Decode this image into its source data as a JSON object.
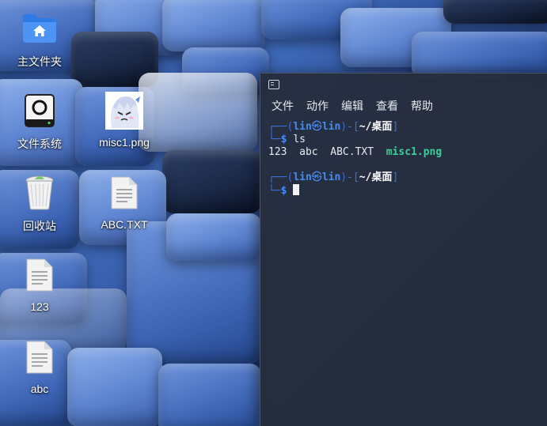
{
  "desktop": {
    "icons": [
      {
        "label": "主文件夹",
        "icon": "home-folder-icon"
      },
      {
        "label": "文件系统",
        "icon": "drive-icon"
      },
      {
        "label": "misc1.png",
        "icon": "image-thumbnail"
      },
      {
        "label": "回收站",
        "icon": "trash-icon"
      },
      {
        "label": "ABC.TXT",
        "icon": "text-file-icon"
      },
      {
        "label": "123",
        "icon": "text-file-icon"
      },
      {
        "label": "abc",
        "icon": "text-file-icon"
      }
    ]
  },
  "terminal": {
    "menu": [
      "文件",
      "动作",
      "编辑",
      "查看",
      "帮助"
    ],
    "user": "lin",
    "host": "lin",
    "path": "~/桌面",
    "command": "ls",
    "ls_output": [
      "123",
      "abc",
      "ABC.TXT",
      "misc1.png"
    ],
    "colors": {
      "prompt_box": "#3d6fd8",
      "prompt_user": "#4a8bf0",
      "image_file": "#3ccf99",
      "background": "#262c3a"
    }
  }
}
